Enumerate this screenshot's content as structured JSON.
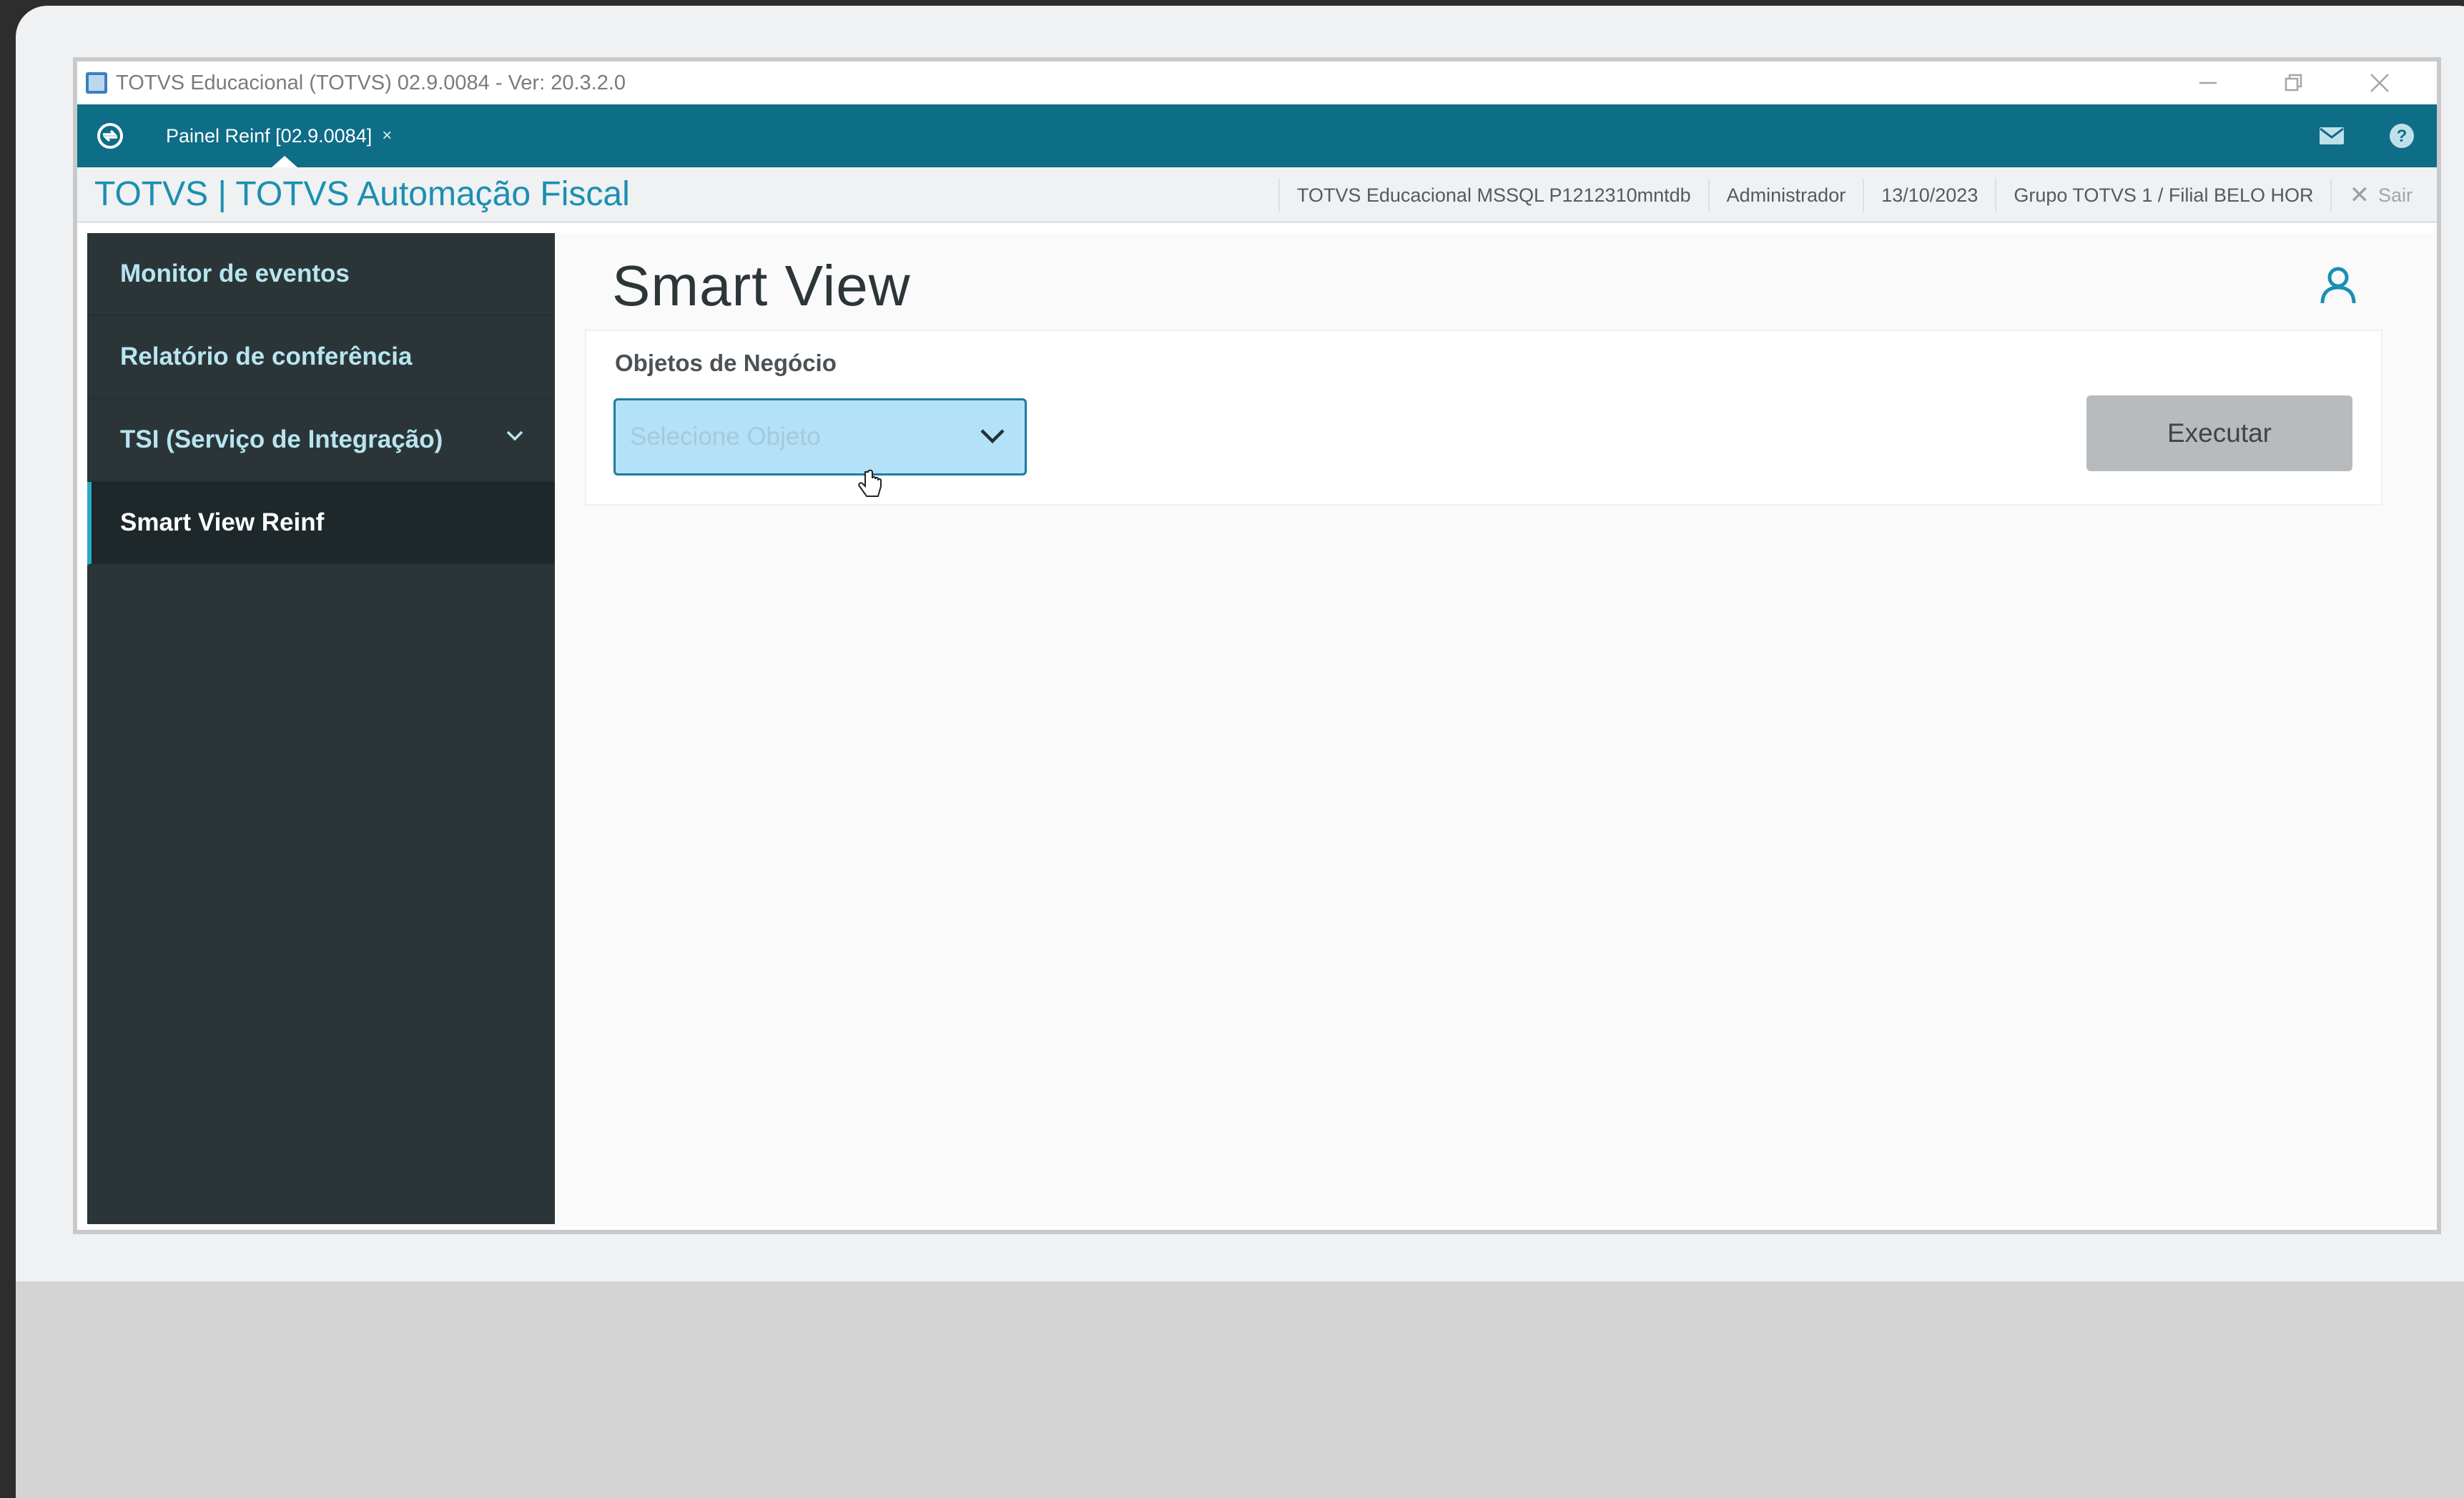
{
  "window": {
    "title": "TOTVS Educacional (TOTVS) 02.9.0084 - Ver: 20.3.2.0"
  },
  "topbar": {
    "tab_label": "Painel Reinf [02.9.0084]",
    "tab_close": "×"
  },
  "header": {
    "brand": "TOTVS | TOTVS Automação Fiscal",
    "environment": "TOTVS Educacional MSSQL P1212310mntdb",
    "user": "Administrador",
    "date": "13/10/2023",
    "company": "Grupo TOTVS 1 / Filial BELO HOR",
    "logout_label": "Sair"
  },
  "sidebar": {
    "items": [
      {
        "label": "Monitor de eventos"
      },
      {
        "label": "Relatório de conferência"
      },
      {
        "label": "TSI (Serviço de Integração)"
      },
      {
        "label": "Smart View Reinf",
        "active": true
      }
    ]
  },
  "main": {
    "title": "Smart View",
    "field_label": "Objetos de Negócio",
    "select_placeholder": "Selecione Objeto",
    "execute_label": "Executar"
  },
  "colors": {
    "topbar": "#0e6d87",
    "brand": "#1b8fb1",
    "sidebar": "#2b3538",
    "select_bg": "#b3e1f7",
    "execute_bg": "#b7bbbd"
  },
  "icons": [
    "app-icon",
    "refresh-home-icon",
    "mail-icon",
    "help-icon",
    "close-x-icon",
    "chevron-down-icon",
    "user-icon",
    "hand-cursor-icon"
  ]
}
